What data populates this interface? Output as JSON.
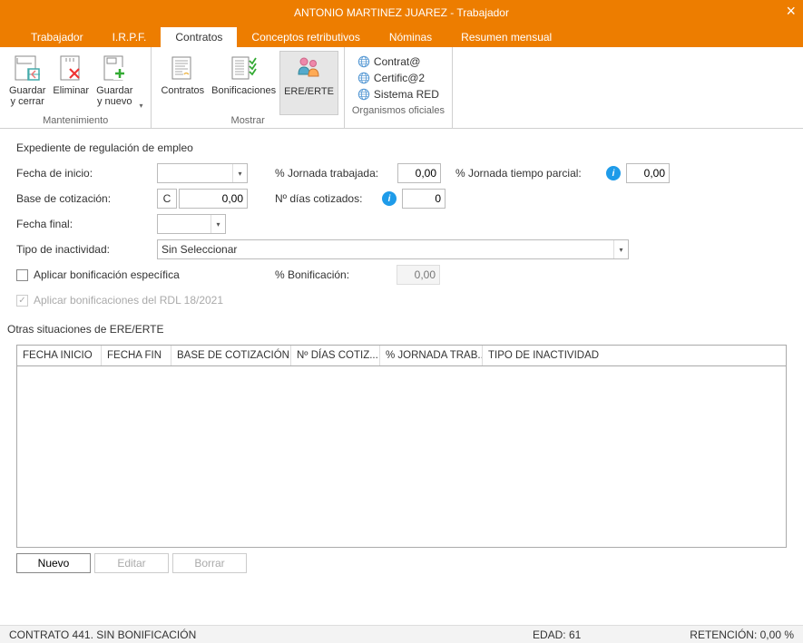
{
  "window": {
    "title": "ANTONIO MARTINEZ JUAREZ - Trabajador"
  },
  "tabs": [
    "Trabajador",
    "I.R.P.F.",
    "Contratos",
    "Conceptos retributivos",
    "Nóminas",
    "Resumen mensual"
  ],
  "active_tab": "Contratos",
  "ribbon": {
    "groups": {
      "mantenimiento": {
        "label": "Mantenimiento",
        "guardar_cerrar": "Guardar\ny cerrar",
        "eliminar": "Eliminar",
        "guardar_nuevo": "Guardar\ny nuevo"
      },
      "mostrar": {
        "label": "Mostrar",
        "contratos": "Contratos",
        "bonificaciones": "Bonificaciones",
        "ere": "ERE/ERTE"
      },
      "organismos": {
        "label": "Organismos oficiales",
        "contrata": "Contrat@",
        "certifica": "Certific@2",
        "sistema_red": "Sistema RED"
      }
    }
  },
  "form": {
    "section_title": "Expediente de regulación de empleo",
    "fecha_inicio_lbl": "Fecha de inicio:",
    "fecha_inicio_val": "",
    "base_cotizacion_lbl": "Base de cotización:",
    "base_cotizacion_btn": "C",
    "base_cotizacion_val": "0,00",
    "fecha_final_lbl": "Fecha final:",
    "fecha_final_val": "",
    "tipo_inactividad_lbl": "Tipo de inactividad:",
    "tipo_inactividad_val": "Sin Seleccionar",
    "jornada_trabajada_lbl": "% Jornada trabajada:",
    "jornada_trabajada_val": "0,00",
    "dias_cotizados_lbl": "Nº días cotizados:",
    "dias_cotizados_val": "0",
    "jornada_parcial_lbl": "% Jornada tiempo parcial:",
    "jornada_parcial_val": "0,00",
    "aplicar_bonif_esp_lbl": "Aplicar bonificación específica",
    "bonificacion_lbl": "% Bonificación:",
    "bonificacion_val": "0,00",
    "aplicar_bonif_rdl_lbl": "Aplicar bonificaciones del RDL 18/2021"
  },
  "grid": {
    "title": "Otras situaciones de ERE/ERTE",
    "headers": [
      "FECHA INICIO",
      "FECHA FIN",
      "BASE DE COTIZACIÓN",
      "Nº DÍAS COTIZ...",
      "% JORNADA TRAB...",
      "TIPO DE INACTIVIDAD"
    ],
    "buttons": {
      "nuevo": "Nuevo",
      "editar": "Editar",
      "borrar": "Borrar"
    }
  },
  "status": {
    "contrato": "CONTRATO 441.  SIN BONIFICACIÓN",
    "edad": "EDAD: 61",
    "retencion": "RETENCIÓN: 0,00 %"
  }
}
